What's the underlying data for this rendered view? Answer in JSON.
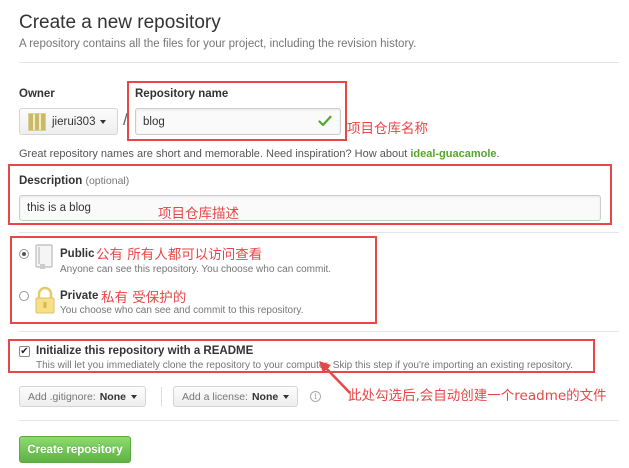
{
  "header": {
    "title": "Create a new repository",
    "subtitle": "A repository contains all the files for your project, including the revision history."
  },
  "owner": {
    "label": "Owner",
    "value": "jierui303",
    "icon": "identicon-avatar"
  },
  "repo_name": {
    "label": "Repository name",
    "value": "blog",
    "valid_icon": "check-icon"
  },
  "hint": {
    "text": "Great repository names are short and memorable. Need inspiration? How about ",
    "suggestion": "ideal-guacamole",
    "suffix": "."
  },
  "description": {
    "label": "Description",
    "optional": "(optional)",
    "value": "this is a blog"
  },
  "visibility": {
    "public": {
      "title": "Public",
      "desc": "Anyone can see this repository. You choose who can commit.",
      "selected": true,
      "icon": "repo-book-icon"
    },
    "private": {
      "title": "Private",
      "desc": "You choose who can see and commit to this repository.",
      "selected": false,
      "icon": "lock-icon"
    }
  },
  "readme": {
    "checked": true,
    "checkmark": "✔",
    "title": "Initialize this repository with a README",
    "desc": "This will let you immediately clone the repository to your computer. Skip this step if you're importing an existing repository."
  },
  "gitignore": {
    "label": "Add .gitignore:",
    "value": "None"
  },
  "license": {
    "label": "Add a license:",
    "value": "None"
  },
  "info_glyph": "i",
  "submit": {
    "label": "Create repository"
  },
  "annotations": {
    "name_note": "项目仓库名称",
    "desc_note": "项目仓库描述",
    "public_note": "公有   所有人都可以访问查看",
    "private_note": "私有  受保护的",
    "readme_note": "此处勾选后,会自动创建一个readme的文件"
  },
  "colors": {
    "annotation_red": "#e8474a",
    "accent_green": "#55a532",
    "button_green": "#60b044"
  }
}
